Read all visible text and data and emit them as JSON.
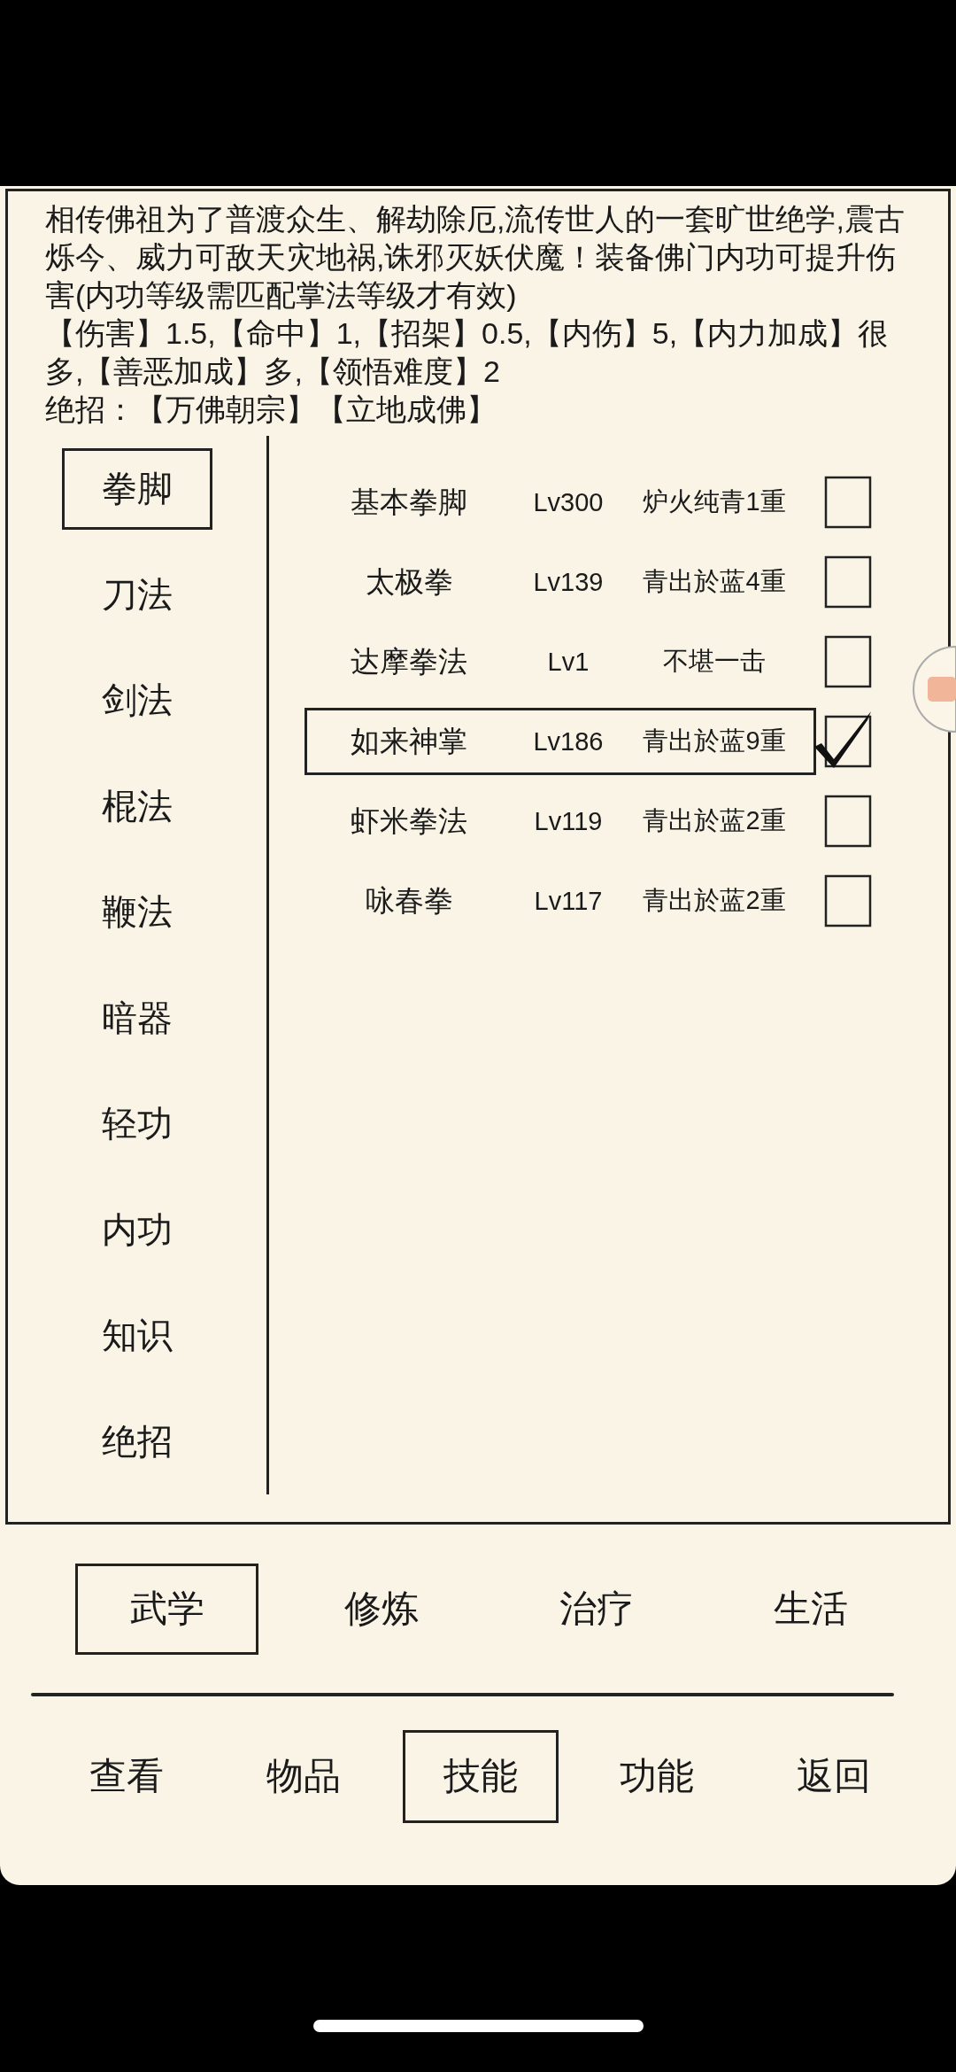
{
  "description": "相传佛祖为了普渡众生、解劫除厄,流传世人的一套旷世绝学,震古烁今、威力可敌天灾地祸,诛邪灭妖伏魔！装备佛门内功可提升伤害(内功等级需匹配掌法等级才有效)",
  "stats": "【伤害】1.5,【命中】1,【招架】0.5,【内伤】5,【内力加成】很多,【善恶加成】多,【领悟难度】2",
  "ultimate": "绝招：【万佛朝宗】【立地成佛】",
  "categories": [
    {
      "label": "拳脚",
      "selected": true
    },
    {
      "label": "刀法",
      "selected": false
    },
    {
      "label": "剑法",
      "selected": false
    },
    {
      "label": "棍法",
      "selected": false
    },
    {
      "label": "鞭法",
      "selected": false
    },
    {
      "label": "暗器",
      "selected": false
    },
    {
      "label": "轻功",
      "selected": false
    },
    {
      "label": "内功",
      "selected": false
    },
    {
      "label": "知识",
      "selected": false
    },
    {
      "label": "绝招",
      "selected": false
    }
  ],
  "skills": [
    {
      "name": "基本拳脚",
      "level": "Lv300",
      "rank": "炉火纯青1重",
      "selected": false,
      "checked": false
    },
    {
      "name": "太极拳",
      "level": "Lv139",
      "rank": "青出於蓝4重",
      "selected": false,
      "checked": false
    },
    {
      "name": "达摩拳法",
      "level": "Lv1",
      "rank": "不堪一击",
      "selected": false,
      "checked": false
    },
    {
      "name": "如来神掌",
      "level": "Lv186",
      "rank": "青出於蓝9重",
      "selected": true,
      "checked": true
    },
    {
      "name": "虾米拳法",
      "level": "Lv119",
      "rank": "青出於蓝2重",
      "selected": false,
      "checked": false
    },
    {
      "name": "咏春拳",
      "level": "Lv117",
      "rank": "青出於蓝2重",
      "selected": false,
      "checked": false
    }
  ],
  "tabs": [
    {
      "label": "武学",
      "selected": true
    },
    {
      "label": "修炼",
      "selected": false
    },
    {
      "label": "治疗",
      "selected": false
    },
    {
      "label": "生活",
      "selected": false
    }
  ],
  "nav": [
    {
      "label": "查看",
      "selected": false
    },
    {
      "label": "物品",
      "selected": false
    },
    {
      "label": "技能",
      "selected": true
    },
    {
      "label": "功能",
      "selected": false
    },
    {
      "label": "返回",
      "selected": false
    }
  ]
}
